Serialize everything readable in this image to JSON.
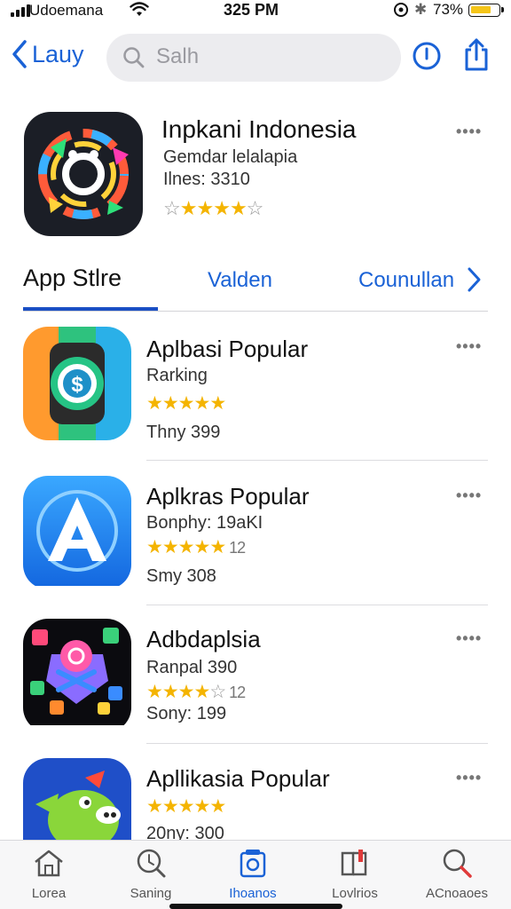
{
  "status_bar": {
    "carrier": "Udoemana",
    "time": "325 PM",
    "battery": "73%"
  },
  "header": {
    "back_label": "Lauy",
    "search_placeholder": "Salh"
  },
  "featured": {
    "title": "Inpkani Indonesia",
    "subtitle": "Gemdar lelalapia",
    "meta": "Ilnes: 3310",
    "rating": 4,
    "more": "••••"
  },
  "tabs": {
    "items": [
      "App Stlre",
      "Valden",
      "Counullan"
    ],
    "active": "App Stlre"
  },
  "apps": [
    {
      "title": "Aplbasi Popular",
      "subtitle": "Rarking",
      "rating": 5,
      "meta": "Thny 399",
      "count": "",
      "more": "••••"
    },
    {
      "title": "Aplkras Popular",
      "subtitle": "Bonphy: 19aKI",
      "rating": 5,
      "meta": "Smy 308",
      "count": "12",
      "more": "••••"
    },
    {
      "title": "Adbdaplsia",
      "subtitle": "Ranpal 390",
      "rating": 4,
      "meta": "Sony: 199",
      "count": "12",
      "more": "••••"
    },
    {
      "title": "Apllikasia Popular",
      "subtitle": "",
      "rating": 5,
      "meta": "20ny: 300",
      "count": "",
      "more": "••••"
    }
  ],
  "tabbar": [
    {
      "label": "Lorea",
      "icon": "home-icon"
    },
    {
      "label": "Saning",
      "icon": "search-circle-icon"
    },
    {
      "label": "Ihoanos",
      "icon": "store-icon"
    },
    {
      "label": "Lovlrios",
      "icon": "book-icon"
    },
    {
      "label": "ACnoaoes",
      "icon": "magnifier-icon"
    }
  ],
  "colors": {
    "accent": "#1a62d6",
    "star": "#f4b400"
  }
}
